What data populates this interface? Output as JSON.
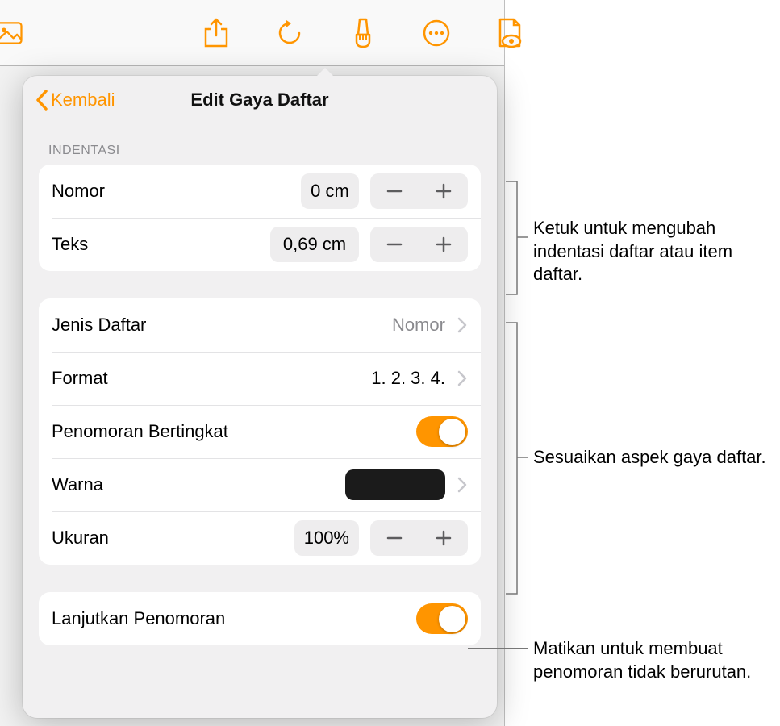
{
  "toolbar": {
    "icons": [
      "photo-icon",
      "share-icon",
      "undo-icon",
      "brush-icon",
      "more-icon",
      "document-view-icon"
    ]
  },
  "popover": {
    "back_label": "Kembali",
    "title": "Edit Gaya Daftar",
    "sections": {
      "indentasi": {
        "header": "INDENTASI",
        "nomor": {
          "label": "Nomor",
          "value": "0 cm"
        },
        "teks": {
          "label": "Teks",
          "value": "0,69 cm"
        }
      },
      "style": {
        "jenis": {
          "label": "Jenis Daftar",
          "value": "Nomor"
        },
        "format": {
          "label": "Format",
          "value": "1. 2. 3. 4."
        },
        "tiered": {
          "label": "Penomoran Bertingkat",
          "on": true
        },
        "warna": {
          "label": "Warna",
          "value": "#1b1b1b"
        },
        "ukuran": {
          "label": "Ukuran",
          "value": "100%"
        }
      },
      "continue": {
        "label": "Lanjutkan Penomoran",
        "on": true
      }
    }
  },
  "callouts": {
    "indent": "Ketuk untuk mengubah indentasi daftar atau item daftar.",
    "style": "Sesuaikan aspek gaya daftar.",
    "continue": "Matikan untuk membuat penomoran tidak berurutan."
  }
}
